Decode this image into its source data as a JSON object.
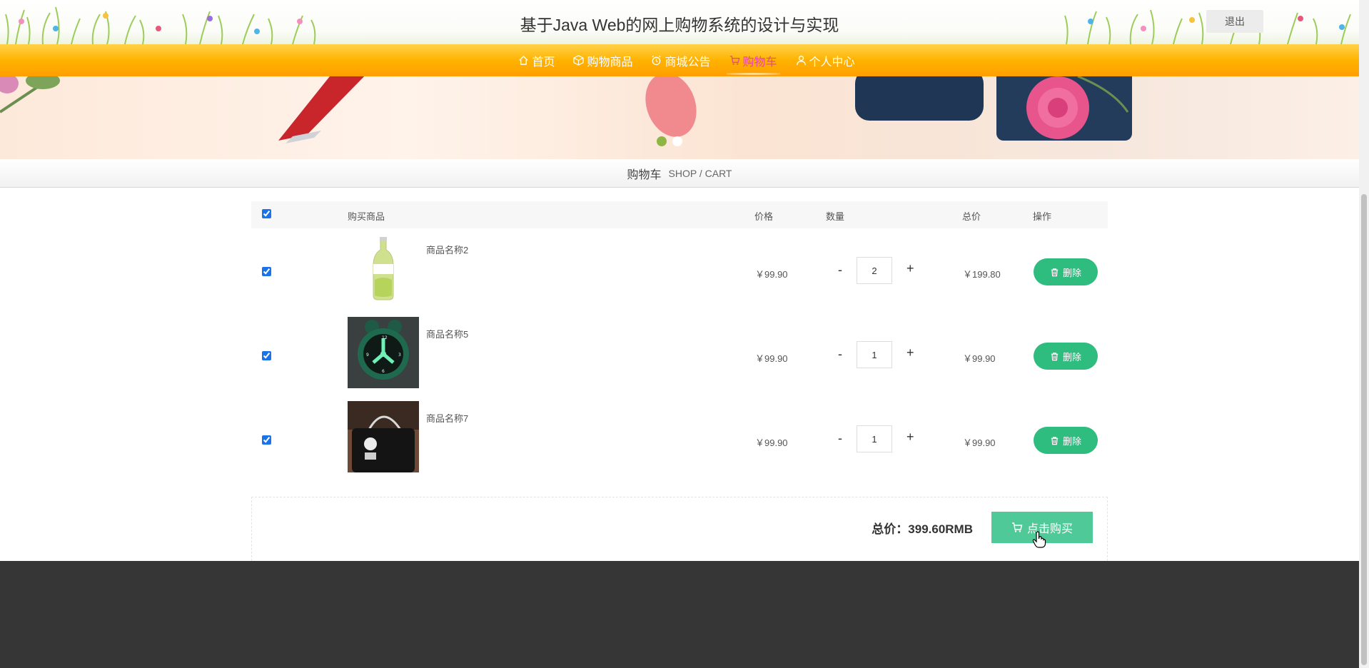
{
  "header": {
    "title": "基于Java Web的网上购物系统的设计与实现",
    "logout_label": "退出"
  },
  "nav": {
    "items": [
      {
        "label": "首页",
        "icon": "home-icon"
      },
      {
        "label": "购物商品",
        "icon": "box-icon"
      },
      {
        "label": "商城公告",
        "icon": "alarm-icon"
      },
      {
        "label": "购物车",
        "icon": "cart-icon",
        "active": true
      },
      {
        "label": "个人中心",
        "icon": "user-icon"
      }
    ]
  },
  "breadcrumb": {
    "title": "购物车",
    "subtitle": "SHOP / CART"
  },
  "cart": {
    "columns": {
      "product": "购买商品",
      "price": "价格",
      "quantity": "数量",
      "total": "总价",
      "action": "操作"
    },
    "rows": [
      {
        "name": "商品名称2",
        "price": "￥99.90",
        "quantity": "2",
        "total": "￥199.80",
        "image": "drink-bottle",
        "checked": true
      },
      {
        "name": "商品名称5",
        "price": "￥99.90",
        "quantity": "1",
        "total": "￥99.90",
        "image": "alarm-clock",
        "checked": true
      },
      {
        "name": "商品名称7",
        "price": "￥99.90",
        "quantity": "1",
        "total": "￥99.90",
        "image": "black-handbag",
        "checked": true
      }
    ],
    "minus_label": "-",
    "plus_label": "+",
    "delete_label": "删除"
  },
  "summary": {
    "total_label": "总价：399.60RMB",
    "buy_label": "点击购买"
  },
  "colors": {
    "nav_orange": "#ffb300",
    "active_nav": "#e9449b",
    "delete_green": "#2ebd7f",
    "buy_green": "#50c998",
    "footer": "#363636"
  }
}
